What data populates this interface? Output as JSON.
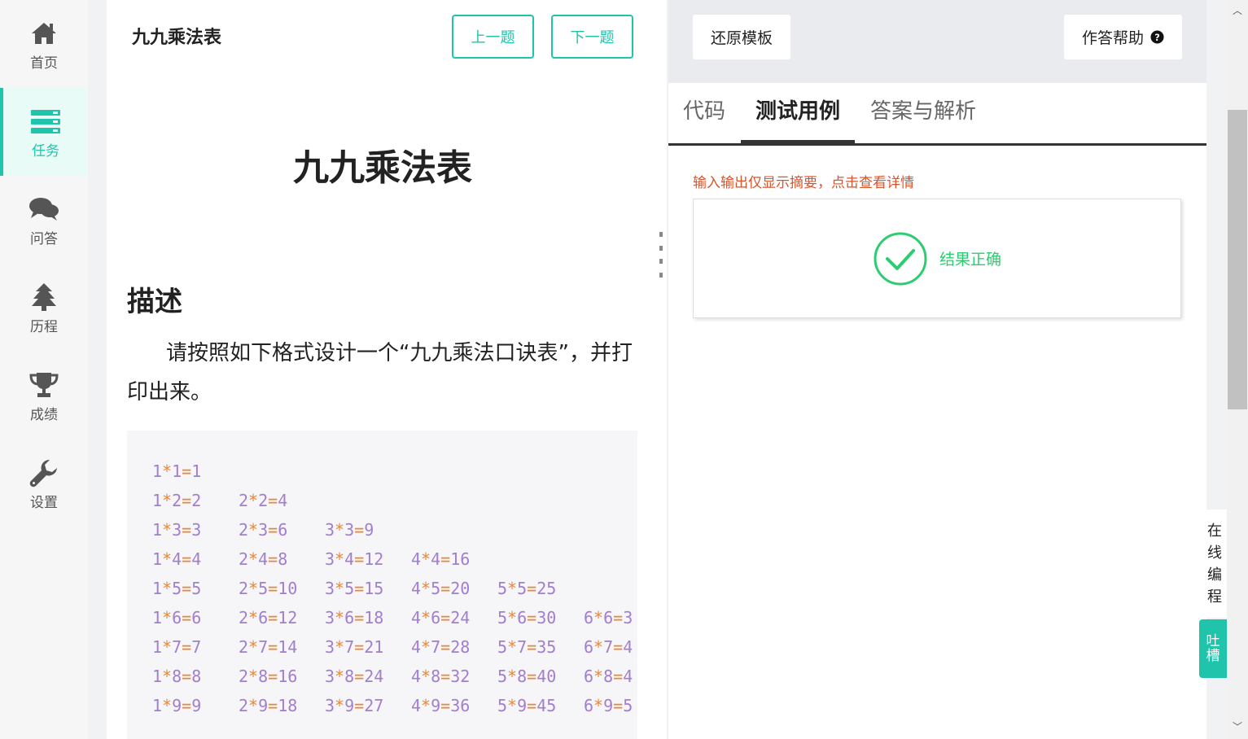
{
  "nav": {
    "items": [
      {
        "label": "首页",
        "icon": "home-icon"
      },
      {
        "label": "任务",
        "icon": "tasks-icon"
      },
      {
        "label": "问答",
        "icon": "comments-icon"
      },
      {
        "label": "历程",
        "icon": "tree-icon"
      },
      {
        "label": "成绩",
        "icon": "trophy-icon"
      },
      {
        "label": "设置",
        "icon": "wrench-icon"
      }
    ],
    "active_index": 1
  },
  "problem": {
    "header_title": "九九乘法表",
    "prev_label": "上一题",
    "next_label": "下一题",
    "title": "九九乘法表",
    "section_heading": "描述",
    "description": "请按照如下格式设计一个“九九乘法口诀表”，并打印出来。",
    "code_rows": [
      [
        "1*1=1"
      ],
      [
        "1*2=2",
        "2*2=4"
      ],
      [
        "1*3=3",
        "2*3=6",
        "3*3=9"
      ],
      [
        "1*4=4",
        "2*4=8",
        "3*4=12",
        "4*4=16"
      ],
      [
        "1*5=5",
        "2*5=10",
        "3*5=15",
        "4*5=20",
        "5*5=25"
      ],
      [
        "1*6=6",
        "2*6=12",
        "3*6=18",
        "4*6=24",
        "5*6=30",
        "6*6=3"
      ],
      [
        "1*7=7",
        "2*7=14",
        "3*7=21",
        "4*7=28",
        "5*7=35",
        "6*7=4"
      ],
      [
        "1*8=8",
        "2*8=16",
        "3*8=24",
        "4*8=32",
        "5*8=40",
        "6*8=4"
      ],
      [
        "1*9=9",
        "2*9=18",
        "3*9=27",
        "4*9=36",
        "5*9=45",
        "6*9=5"
      ]
    ]
  },
  "editor": {
    "restore_label": "还原模板",
    "help_label": "作答帮助",
    "tabs": [
      "代码",
      "测试用例",
      "答案与解析"
    ],
    "active_tab": 1,
    "tip": "输入输出仅显示摘要，点击查看详情",
    "result": "结果正确"
  },
  "side": {
    "online_chars": [
      "在",
      "线",
      "编",
      "程"
    ],
    "feedback_chars": [
      "吐",
      "槽"
    ]
  },
  "colors": {
    "accent": "#1fc4ab",
    "success": "#2ecc71",
    "warning": "#d9532b",
    "code_text": "#a17ecf",
    "code_operator": "#e8863a"
  }
}
